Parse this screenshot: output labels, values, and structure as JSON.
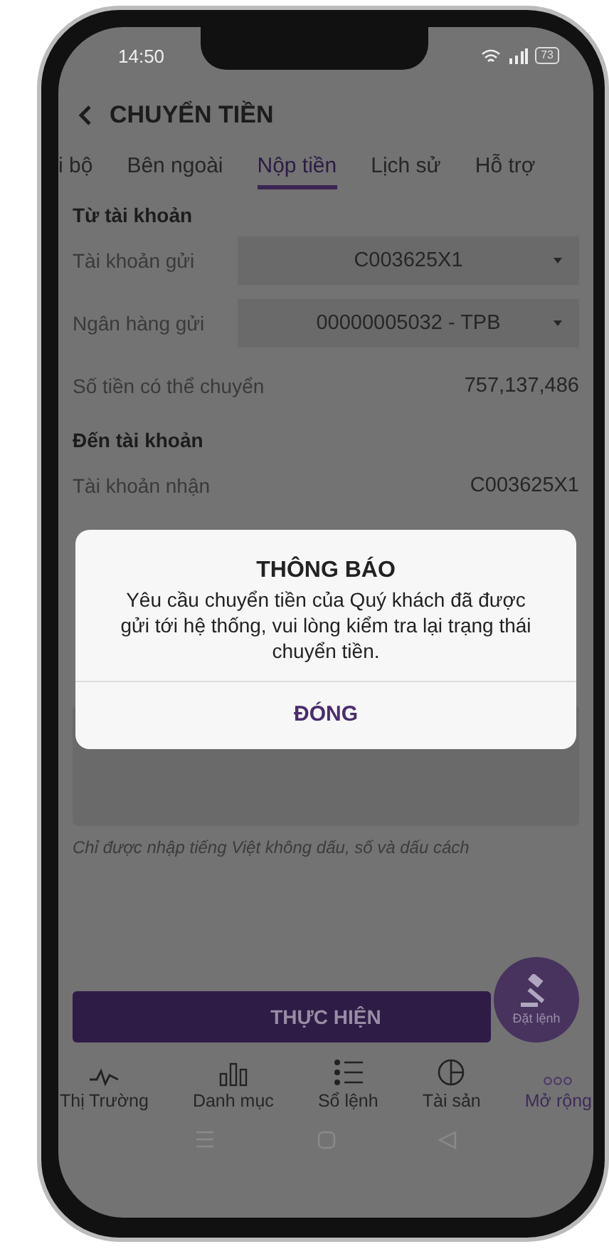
{
  "status_bar": {
    "time": "14:50",
    "battery": "73"
  },
  "header": {
    "title": "CHUYỂN TIỀN"
  },
  "tabs": [
    {
      "label": "i bộ",
      "selected": false
    },
    {
      "label": "Bên ngoài",
      "selected": false
    },
    {
      "label": "Nộp tiền",
      "selected": true
    },
    {
      "label": "Lịch sử",
      "selected": false
    },
    {
      "label": "Hỗ trợ",
      "selected": false
    }
  ],
  "sections": [
    {
      "title": "Từ tài khoản",
      "rows": [
        {
          "kind": "select",
          "label": "Tài khoản gửi",
          "value": "C003625X1"
        },
        {
          "kind": "select",
          "label": "Ngân hàng gửi",
          "value": "00000005032 - TPB"
        },
        {
          "kind": "text",
          "label": "Số tiền có thể chuyển",
          "value": "757,137,486"
        }
      ]
    },
    {
      "title": "Đến tài khoản",
      "rows": [
        {
          "kind": "text",
          "label": "Tài khoản nhận",
          "value": "C003625X1"
        }
      ]
    }
  ],
  "hint": "Chỉ được nhập tiếng Việt không dấu, số và dấu cách",
  "submit_button": "THỰC HIỆN",
  "fab": {
    "label": "Đặt lệnh"
  },
  "bottom_nav": [
    {
      "label": "Thị Trường",
      "selected": false
    },
    {
      "label": "Danh mục",
      "selected": false
    },
    {
      "label": "Sổ lệnh",
      "selected": false
    },
    {
      "label": "Tài sản",
      "selected": false
    },
    {
      "label": "Mở rộng",
      "selected": true
    }
  ],
  "dialog": {
    "title": "THÔNG BÁO",
    "message": "Yêu cầu chuyển tiền của Quý khách đã được gửi tới hệ thống, vui lòng kiểm tra lại trạng thái chuyển tiền.",
    "button": "ĐÓNG"
  }
}
